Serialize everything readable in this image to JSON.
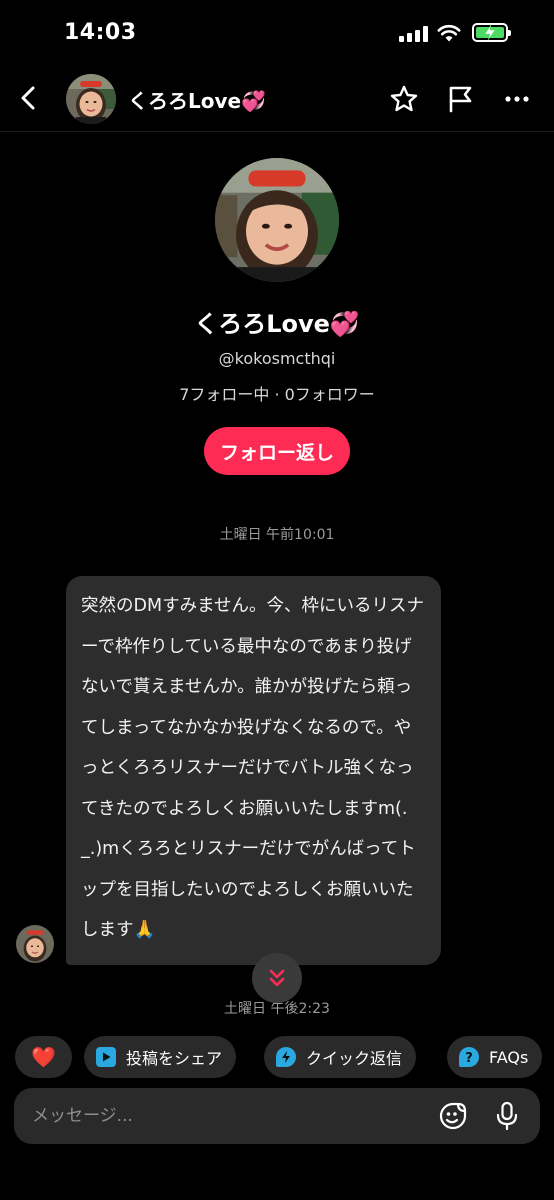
{
  "status_bar": {
    "time": "14:03"
  },
  "header": {
    "name": "くろろLove💞"
  },
  "profile": {
    "name": "くろろLove💞",
    "handle": "@kokosmcthqi",
    "stats": "7フォロー中 · 0フォロワー",
    "follow_button": "フォロー返し"
  },
  "messages": [
    {
      "timestamp": "土曜日 午前10:01",
      "text": "突然のDMすみません。今、枠にいるリスナーで枠作りしている最中なのであまり投げないで貰えませんか。誰かが投げたら頼ってしまってなかなか投げなくなるので。やっとくろろリスナーだけでバトル強くなってきたのでよろしくお願いいたしますm(._.)mくろろとリスナーだけでがんばってトップを目指したいのでよろしくお願いいたします🙏"
    },
    {
      "timestamp": "土曜日 午後2:23"
    }
  ],
  "quick_actions": {
    "heart": "❤️",
    "share_post": "投稿をシェア",
    "quick_reply": "クイック返信",
    "faqs": "FAQs"
  },
  "composer": {
    "placeholder": "メッセージ..."
  },
  "colors": {
    "accent": "#fe2c55",
    "bubble": "#2d2d2d",
    "chip": "#2a2a2a",
    "icon_blue": "#2aa9e0"
  }
}
